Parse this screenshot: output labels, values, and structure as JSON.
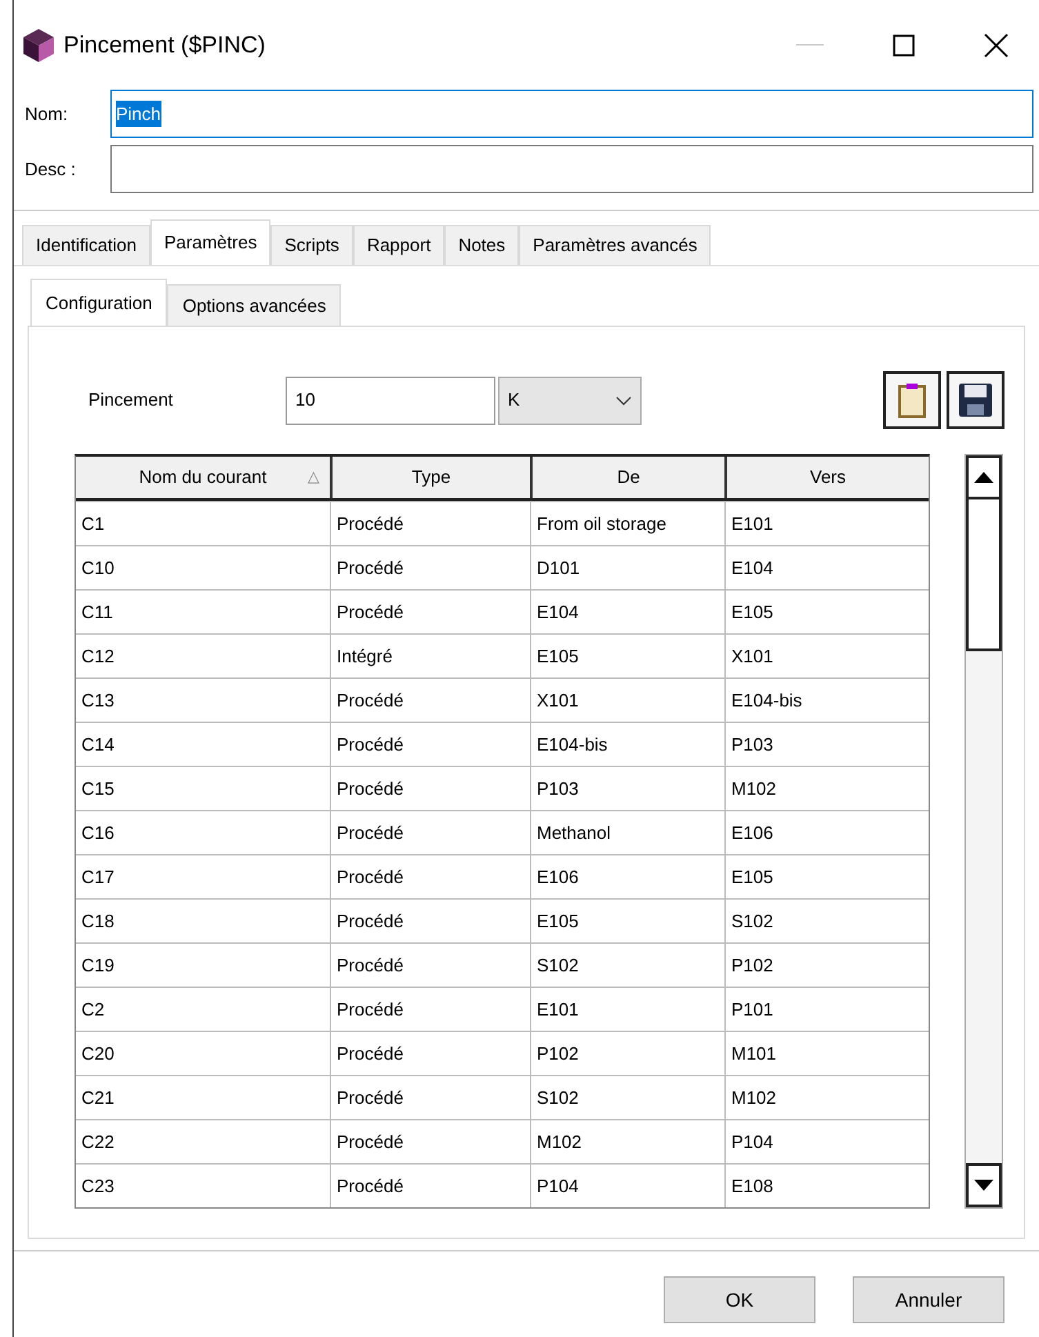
{
  "window": {
    "title": "Pincement ($PINC)"
  },
  "fields": [
    {
      "label": "Nom:",
      "value": "Pinch",
      "focused": true,
      "text_selected": true
    },
    {
      "label": "Desc :",
      "focused": false
    }
  ],
  "tabs": [
    {
      "label": "Identification",
      "selected": false
    },
    {
      "label": "Paramètres",
      "selected": true
    },
    {
      "label": "Scripts",
      "selected": false
    },
    {
      "label": "Rapport",
      "selected": false
    },
    {
      "label": "Notes",
      "selected": false
    },
    {
      "label": "Paramètres avancés",
      "selected": false
    }
  ],
  "subtabs": [
    {
      "label": "Configuration",
      "selected": true
    },
    {
      "label": "Options avancées",
      "selected": false
    }
  ],
  "pinch": {
    "label": "Pincement",
    "value": "10",
    "unit": "K"
  },
  "table": {
    "columns": [
      {
        "label": "Nom du courant",
        "sort_mark": "△"
      },
      {
        "label": "Type"
      },
      {
        "label": "De"
      },
      {
        "label": "Vers"
      }
    ],
    "rows": [
      [
        "C1",
        "Procédé",
        "From oil storage",
        "E101"
      ],
      [
        "C10",
        "Procédé",
        "D101",
        "E104"
      ],
      [
        "C11",
        "Procédé",
        "E104",
        "E105"
      ],
      [
        "C12",
        "Intégré",
        "E105",
        "X101"
      ],
      [
        "C13",
        "Procédé",
        "X101",
        "E104-bis"
      ],
      [
        "C14",
        "Procédé",
        "E104-bis",
        "P103"
      ],
      [
        "C15",
        "Procédé",
        "P103",
        "M102"
      ],
      [
        "C16",
        "Procédé",
        "Methanol",
        "E106"
      ],
      [
        "C17",
        "Procédé",
        "E106",
        "E105"
      ],
      [
        "C18",
        "Procédé",
        "E105",
        "S102"
      ],
      [
        "C19",
        "Procédé",
        "S102",
        "P102"
      ],
      [
        "C2",
        "Procédé",
        "E101",
        "P101"
      ],
      [
        "C20",
        "Procédé",
        "P102",
        "M101"
      ],
      [
        "C21",
        "Procédé",
        "S102",
        "M102"
      ],
      [
        "C22",
        "Procédé",
        "M102",
        "P104"
      ],
      [
        "C23",
        "Procédé",
        "P104",
        "E108"
      ]
    ]
  },
  "buttons": [
    "OK",
    "Annuler"
  ]
}
